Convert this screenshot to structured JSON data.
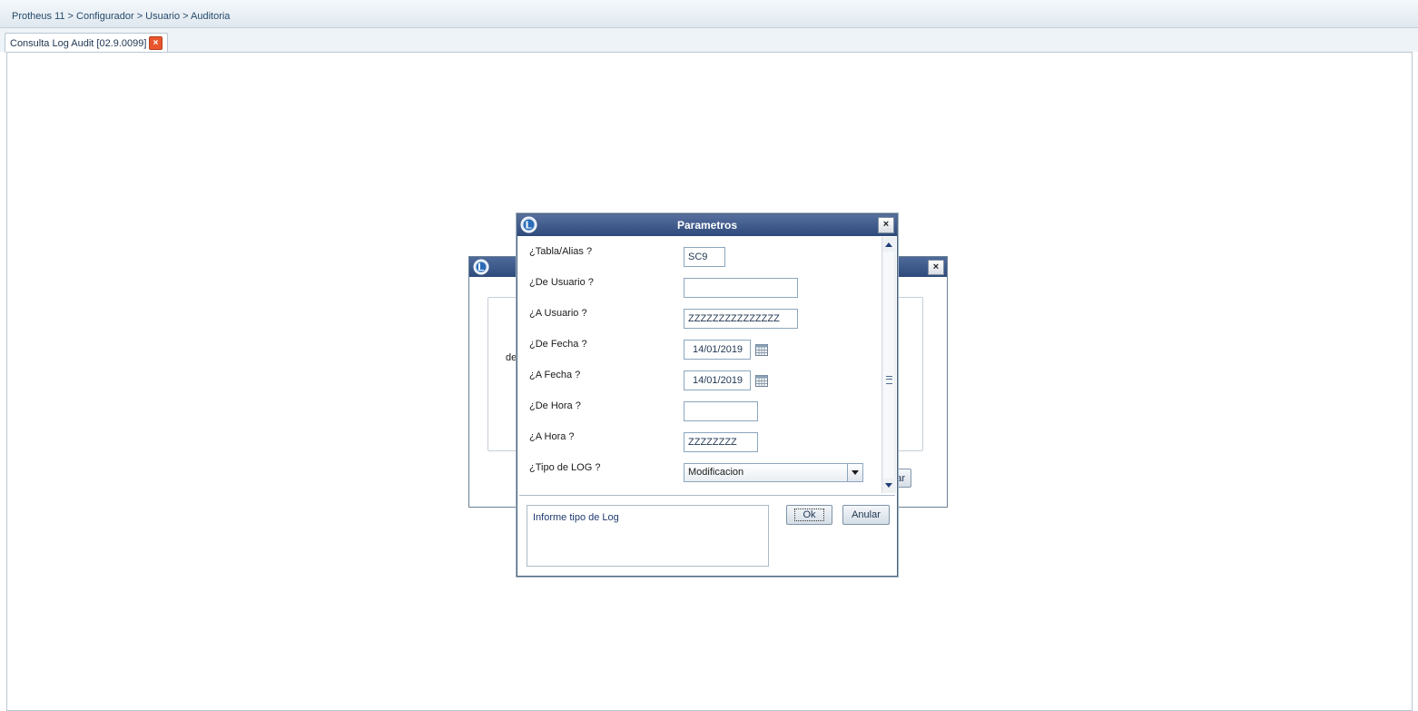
{
  "breadcrumb": "Protheus 11 > Configurador > Usuario > Auditoria",
  "tab": {
    "label": "Consulta Log Audit [02.9.0099]"
  },
  "background_dialog": {
    "partial_text": "de",
    "partial_button": "ar"
  },
  "dialog": {
    "title": "Parametros",
    "close_glyph": "×",
    "fields": [
      {
        "label": "¿Tabla/Alias ?",
        "value": "SC9"
      },
      {
        "label": "¿De Usuario ?",
        "value": ""
      },
      {
        "label": "¿A Usuario ?",
        "value": "ZZZZZZZZZZZZZZZ"
      },
      {
        "label": "¿De Fecha ?",
        "value": "14/01/2019"
      },
      {
        "label": "¿A Fecha ?",
        "value": "14/01/2019"
      },
      {
        "label": "¿De Hora ?",
        "value": ""
      },
      {
        "label": "¿A Hora ?",
        "value": "ZZZZZZZZ"
      },
      {
        "label": "¿Tipo de LOG ?",
        "value": "Modificacion"
      }
    ],
    "help_text": "Informe tipo de Log",
    "ok_label": "Ok",
    "cancel_label": "Anular"
  },
  "colors": {
    "title_bar": "#2e4a7b",
    "accent_close": "#e8552d"
  }
}
